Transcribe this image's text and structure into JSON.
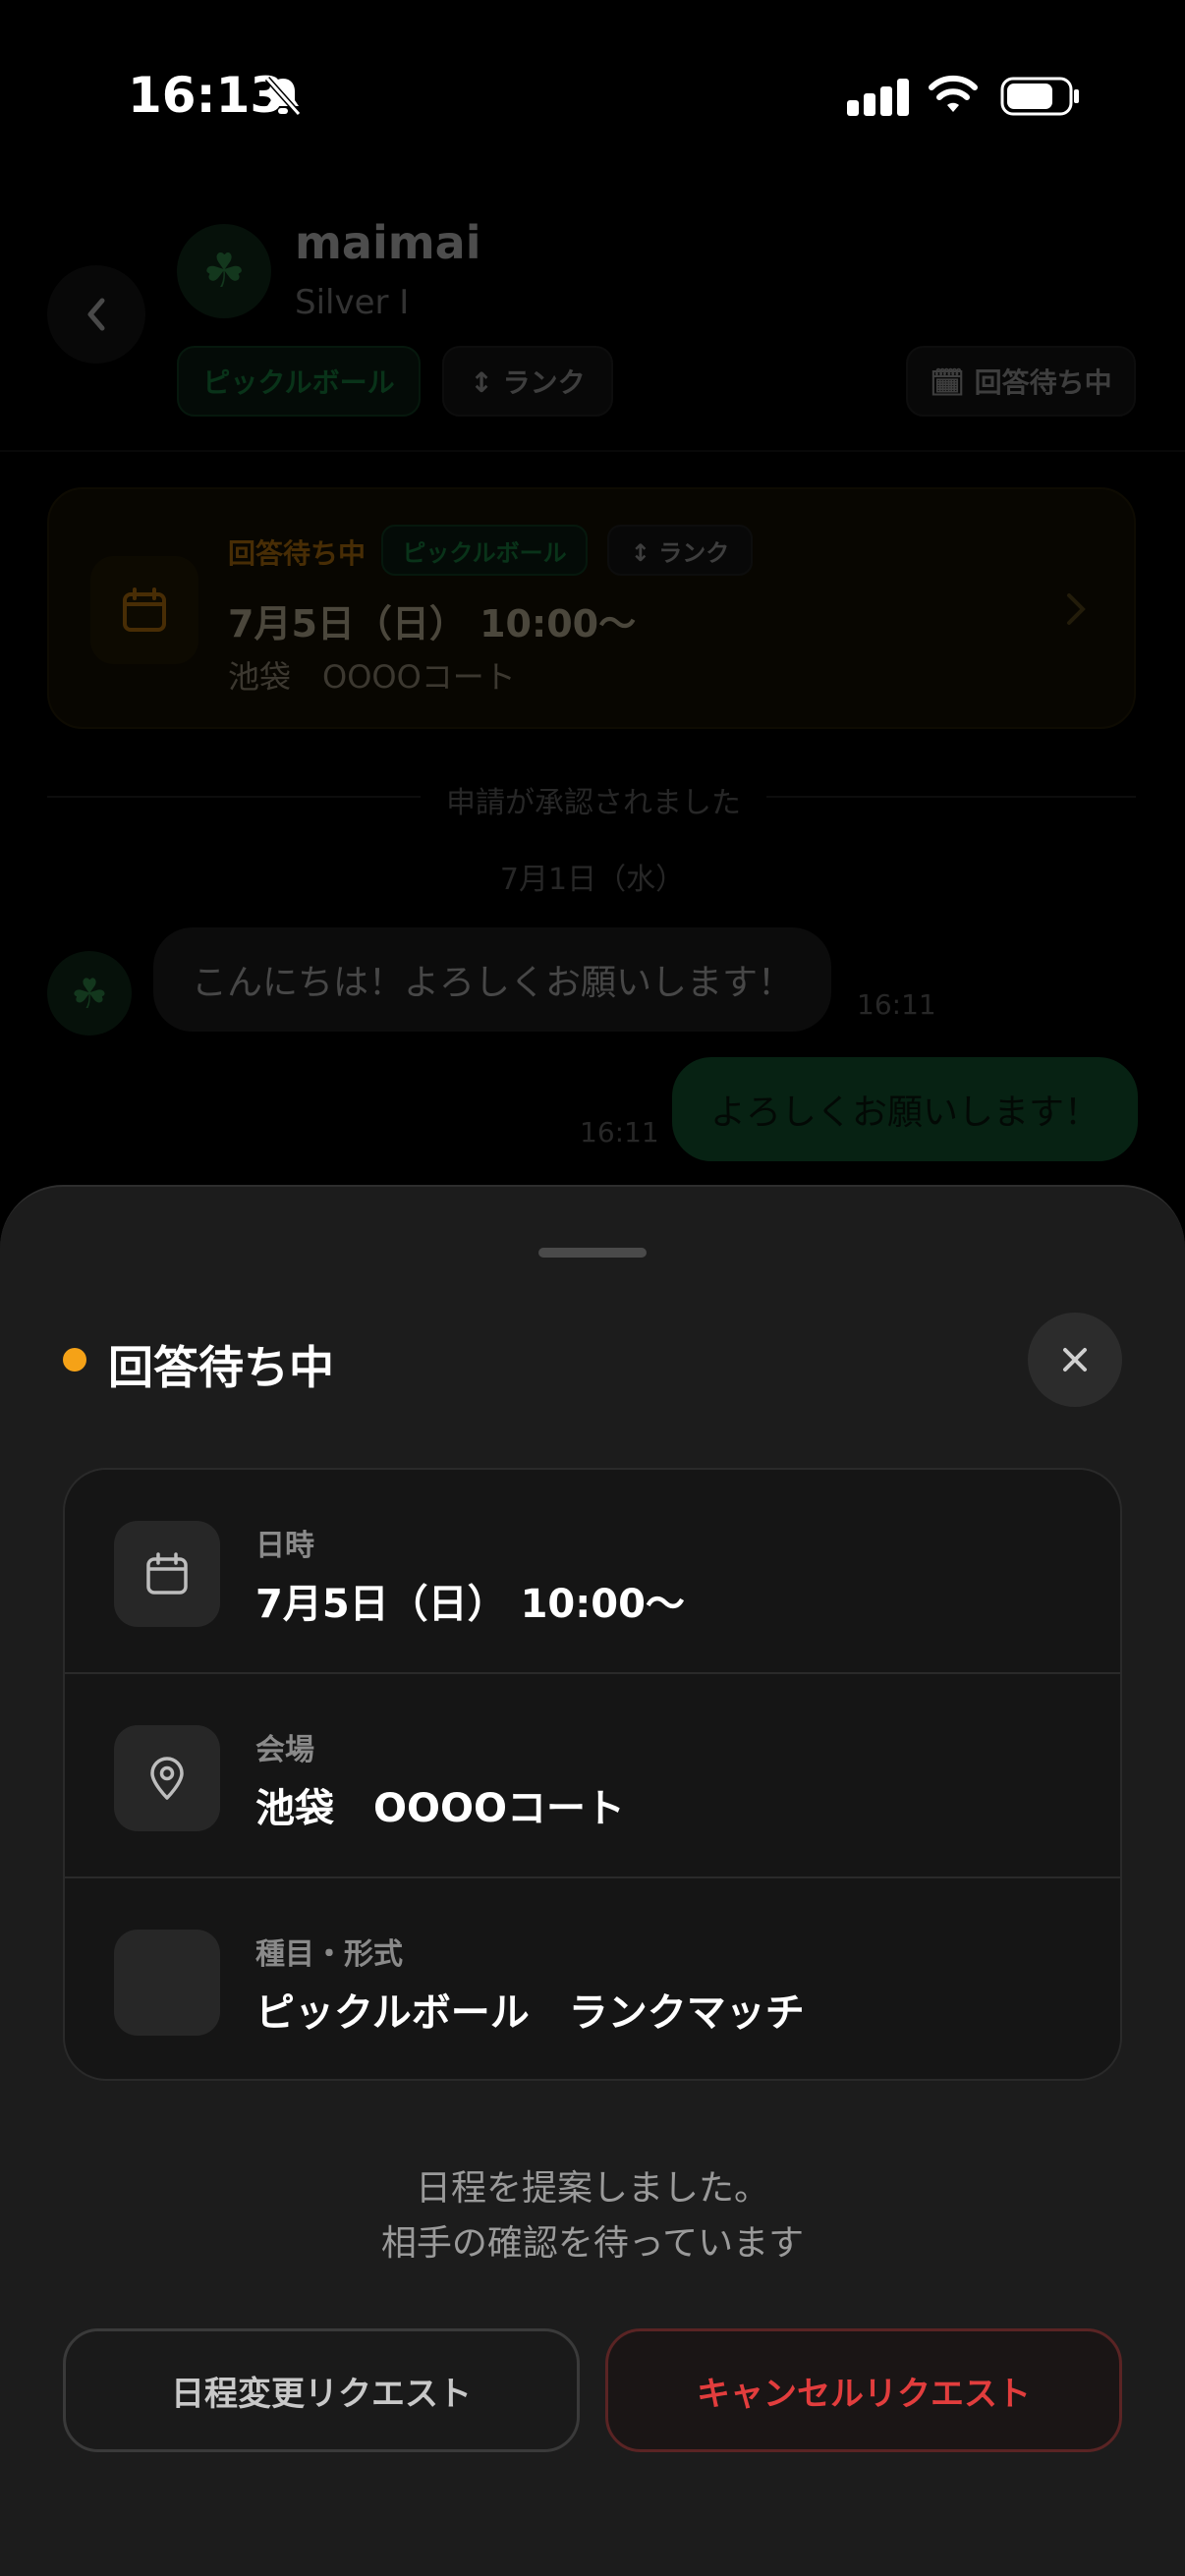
{
  "status_bar": {
    "time": "16:13"
  },
  "chat_header": {
    "user_name": "maimai",
    "user_rank": "Silver I",
    "tags": [
      "ピックルボール",
      "↕ ランク"
    ],
    "status_chip": "🗓 回答待ち中"
  },
  "event_card": {
    "status": "回答待ち中",
    "sport": "ピックルボール",
    "format": "↕ ランク",
    "date": "7月5日（日） 10:00〜",
    "venue": "池袋　OOOOコート"
  },
  "chat": {
    "system_message": "申請が承認されました",
    "date_separator": "7月1日（水）",
    "messages": [
      {
        "text": "こんにちは！よろしくお願いします！",
        "time": "16:11",
        "direction": "incoming"
      },
      {
        "text": "よろしくお願いします！",
        "time": "16:11",
        "direction": "outgoing"
      }
    ]
  },
  "sheet": {
    "status_title": "回答待ち中",
    "status_color": "#f5a217",
    "details": [
      {
        "label": "日時",
        "value": "7月5日（日） 10:00〜",
        "icon": "calendar-icon"
      },
      {
        "label": "会場",
        "value": "池袋　OOOOコート",
        "icon": "location-pin-icon"
      },
      {
        "label": "種目・形式",
        "value": "ピックルボール　ランクマッチ",
        "icon": ""
      }
    ],
    "info_line1": "日程を提案しました。",
    "info_line2": "相手の確認を待っています",
    "reschedule_label": "日程変更リクエスト",
    "cancel_label": "キャンセルリクエスト"
  }
}
